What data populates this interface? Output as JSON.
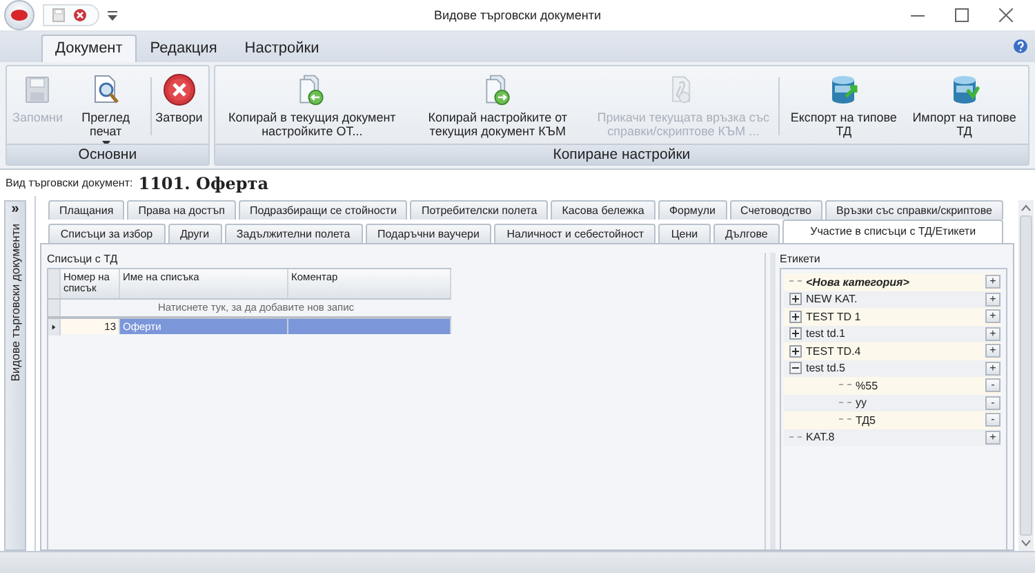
{
  "window": {
    "title": "Видове търговски документи"
  },
  "ribbon": {
    "tabs": [
      {
        "label": "Документ",
        "selected": true
      },
      {
        "label": "Редакция",
        "selected": false
      },
      {
        "label": "Настройки",
        "selected": false
      }
    ],
    "groups": [
      {
        "label": "Основни",
        "buttons": [
          {
            "label": "Запомни",
            "kind": "save",
            "disabled": true,
            "dropdown": false,
            "separated": false
          },
          {
            "label": "Преглед печат",
            "kind": "preview",
            "disabled": false,
            "dropdown": true,
            "separated": false
          },
          {
            "label": "Затвори",
            "kind": "close",
            "disabled": false,
            "dropdown": false,
            "separated": true
          }
        ]
      },
      {
        "label": "Копиране настройки",
        "buttons": [
          {
            "label": "Копирай в текущия документ настройките ОТ...",
            "kind": "copy-from",
            "disabled": false,
            "dropdown": false,
            "separated": false
          },
          {
            "label": "Копирай настройките от текущия документ КЪМ",
            "kind": "copy-to",
            "disabled": false,
            "dropdown": false,
            "separated": false
          },
          {
            "label": "Прикачи текущата връзка със справки/скриптове КЪМ ...",
            "kind": "attach",
            "disabled": true,
            "dropdown": false,
            "separated": false
          },
          {
            "label": "Експорт на типове ТД",
            "kind": "export",
            "disabled": false,
            "dropdown": false,
            "separated": true
          },
          {
            "label": "Импорт на типове ТД",
            "kind": "import",
            "disabled": false,
            "dropdown": false,
            "separated": false
          }
        ]
      }
    ]
  },
  "document": {
    "label": "Вид търговски документ:",
    "value": "1101. Оферта"
  },
  "side_panel": {
    "title": "Видове търговски документи",
    "expand_glyph": "»"
  },
  "tab_rows": [
    {
      "tabs": [
        {
          "label": "Плащания",
          "selected": false
        },
        {
          "label": "Права на достъп",
          "selected": false
        },
        {
          "label": "Подразбиращи се стойности",
          "selected": false
        },
        {
          "label": "Потребителски полета",
          "selected": false
        },
        {
          "label": "Касова бележка",
          "selected": false
        },
        {
          "label": "Формули",
          "selected": false
        },
        {
          "label": "Счетоводство",
          "selected": false
        },
        {
          "label": "Връзки със справки/скриптове",
          "selected": false
        }
      ]
    },
    {
      "tabs": [
        {
          "label": "Списъци за избор",
          "selected": false
        },
        {
          "label": "Други",
          "selected": false
        },
        {
          "label": "Задължителни полета",
          "selected": false
        },
        {
          "label": "Подаръчни ваучери",
          "selected": false
        },
        {
          "label": "Наличност и себестойност",
          "selected": false
        },
        {
          "label": "Цени",
          "selected": false
        },
        {
          "label": "Дългове",
          "selected": false
        },
        {
          "label": "Участие в списъци с ТД/Етикети",
          "selected": true
        }
      ]
    }
  ],
  "lists_panel": {
    "title": "Списъци с ТД",
    "columns": [
      "Номер на списък",
      "Име на списъка",
      "Коментар"
    ],
    "new_row_prompt": "Натиснете тук, за да добавите нов запис",
    "rows": [
      {
        "selected": true,
        "cells": [
          "13",
          "Оферти"
        ]
      }
    ]
  },
  "labels_panel": {
    "title": "Етикети",
    "tree": [
      {
        "kind": "new",
        "label": "<Нова категория>",
        "button": "+"
      },
      {
        "kind": "category",
        "label": "NEW KAT.",
        "expanded": false,
        "button": "+"
      },
      {
        "kind": "category",
        "label": "TEST TD 1",
        "expanded": false,
        "button": "+"
      },
      {
        "kind": "category",
        "label": "test td.1",
        "expanded": false,
        "button": "+"
      },
      {
        "kind": "category",
        "label": "TEST TD.4",
        "expanded": false,
        "button": "+"
      },
      {
        "kind": "category",
        "label": "test td.5",
        "expanded": true,
        "button": "+",
        "children": [
          {
            "kind": "tag",
            "label": "%55",
            "button": "-"
          },
          {
            "kind": "tag",
            "label": "уу",
            "button": "-"
          },
          {
            "kind": "tag",
            "label": "ТД5",
            "button": "-"
          }
        ]
      },
      {
        "kind": "category",
        "label": "KAT.8",
        "button": "+"
      }
    ]
  }
}
